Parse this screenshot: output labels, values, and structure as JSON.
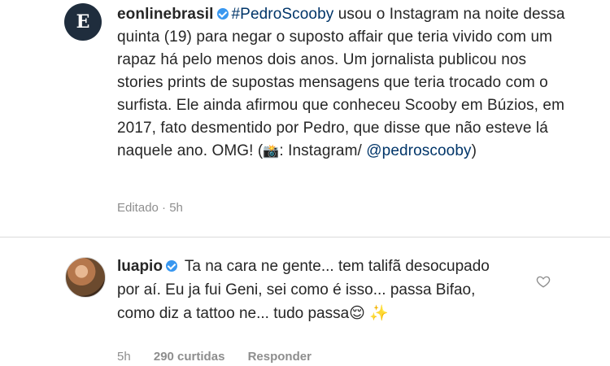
{
  "post": {
    "username": "eonlinebrasil",
    "hashtag": "#PedroScooby",
    "caption_text": "usou o Instagram na noite dessa quinta (19) para negar o suposto affair que teria vivido com um rapaz há pelo menos dois anos. Um jornalista publicou nos stories prints de supostas mensagens que teria trocado com o surfista. Ele ainda afirmou que conheceu Scooby em Búzios, em 2017, fato desmentido por Pedro, que disse que não esteve lá naquele ano. OMG! (",
    "camera_emoji": "📸",
    "caption_tail": ": Instagram/",
    "mention": "@pedroscooby",
    "close_paren": ")",
    "edited_label": "Editado",
    "time": "5h"
  },
  "comment": {
    "username": "luapio",
    "text": "Ta na cara ne gente... tem talifã desocupado por aí. Eu ja fui Geni, sei como é isso... passa Bifao, como diz a tattoo ne... tudo passa😌 ✨",
    "time": "5h",
    "likes": "290 curtidas",
    "reply_label": "Responder"
  },
  "icons": {
    "post_avatar": "e-logo-avatar",
    "comment_avatar": "user-avatar",
    "verified": "verified-badge-icon",
    "like": "heart-outline-icon"
  },
  "colors": {
    "verified": "#3897f0",
    "link": "#003569",
    "meta": "#8e8e8e"
  }
}
